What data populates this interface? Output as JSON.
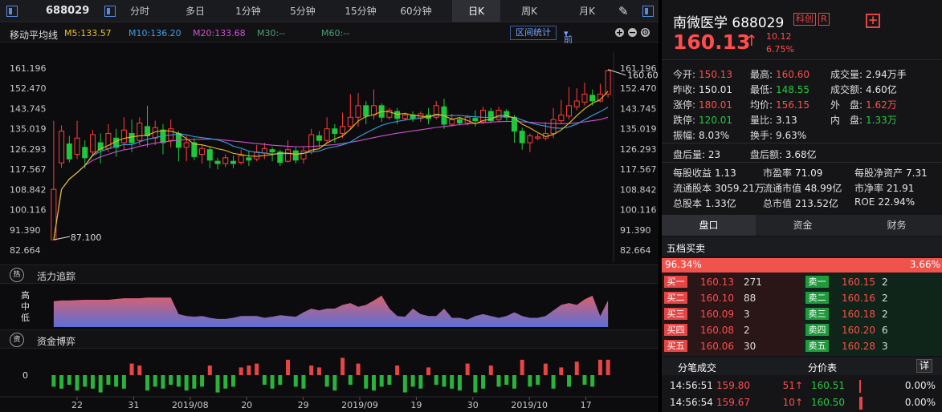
{
  "toolbar": {
    "code": "688029",
    "tabs": [
      "分时",
      "多日",
      "1分钟",
      "5分钟",
      "15分钟",
      "60分钟",
      "日K",
      "周K",
      "月K"
    ],
    "active_tab": "日K"
  },
  "ma_bar": {
    "title": "移动平均线",
    "ma5": "M5:133.57",
    "ma10": "M10:136.20",
    "ma20": "M20:133.68",
    "ma30": "M30:--",
    "ma60": "M60:--",
    "interval_btn": "区间统计",
    "adjust": "前复权",
    "colors": {
      "ma5": "#e8c020",
      "ma10": "#3aa0e6",
      "ma20": "#d050d0",
      "ma30": "#4aa070",
      "ma60": "#4aa070"
    }
  },
  "chart_data": {
    "type": "candlestick",
    "y_ticks": [
      "161.196",
      "152.470",
      "143.745",
      "135.019",
      "126.293",
      "117.567",
      "108.842",
      "100.116",
      "91.390",
      "82.664"
    ],
    "ylim": [
      82.664,
      161.196
    ],
    "x_ticks": [
      "22",
      "31",
      "2019/08",
      "20",
      "29",
      "2019/09",
      "19",
      "30",
      "2019/10",
      "17"
    ],
    "max_label": "160.600",
    "min_label": "87.100",
    "candles": [
      [
        87.1,
        108.9,
        87.1,
        138.5
      ],
      [
        120.3,
        134.0,
        118.2,
        136.5
      ],
      [
        128.5,
        122.0,
        120.5,
        132.0
      ],
      [
        124.0,
        131.0,
        122.0,
        138.5
      ],
      [
        127.0,
        122.5,
        118.0,
        130.0
      ],
      [
        125.0,
        132.5,
        124.0,
        134.5
      ],
      [
        129.0,
        126.0,
        120.0,
        133.0
      ],
      [
        126.5,
        133.0,
        125.0,
        137.0
      ],
      [
        131.0,
        127.0,
        123.0,
        135.0
      ],
      [
        129.0,
        134.5,
        126.0,
        140.0
      ],
      [
        133.0,
        129.0,
        125.0,
        139.0
      ],
      [
        130.0,
        137.5,
        128.0,
        140.0
      ],
      [
        136.0,
        132.0,
        127.0,
        145.0
      ],
      [
        131.0,
        135.5,
        128.0,
        138.5
      ],
      [
        134.5,
        129.0,
        124.0,
        137.0
      ],
      [
        130.0,
        135.0,
        127.0,
        139.0
      ],
      [
        133.0,
        127.0,
        121.0,
        134.0
      ],
      [
        127.0,
        129.0,
        121.0,
        132.0
      ],
      [
        129.0,
        123.0,
        121.5,
        131.0
      ],
      [
        124.0,
        126.5,
        120.0,
        128.0
      ],
      [
        126.0,
        121.5,
        118.0,
        127.5
      ],
      [
        121.0,
        120.0,
        117.5,
        122.5
      ],
      [
        120.0,
        122.5,
        118.5,
        124.0
      ],
      [
        121.0,
        120.0,
        118.0,
        123.5
      ],
      [
        120.5,
        123.5,
        119.5,
        126.0
      ],
      [
        122.5,
        121.5,
        119.0,
        125.5
      ],
      [
        122.0,
        125.0,
        121.0,
        128.0
      ],
      [
        124.5,
        126.5,
        122.0,
        129.0
      ],
      [
        126.0,
        125.0,
        121.0,
        127.0
      ],
      [
        125.0,
        120.5,
        119.0,
        126.0
      ],
      [
        121.0,
        126.0,
        120.5,
        130.0
      ],
      [
        125.5,
        121.5,
        120.0,
        127.0
      ],
      [
        122.0,
        125.5,
        120.0,
        127.5
      ],
      [
        125.0,
        132.5,
        124.0,
        135.0
      ],
      [
        132.0,
        130.0,
        127.0,
        134.0
      ],
      [
        130.0,
        135.0,
        129.0,
        140.0
      ],
      [
        135.0,
        133.0,
        129.0,
        137.0
      ],
      [
        133.0,
        136.0,
        131.0,
        142.0
      ],
      [
        136.0,
        140.0,
        135.0,
        150.0
      ],
      [
        140.0,
        145.0,
        136.0,
        150.5
      ],
      [
        145.0,
        140.5,
        137.0,
        147.0
      ],
      [
        141.0,
        145.0,
        139.0,
        152.0
      ],
      [
        145.0,
        140.0,
        138.0,
        146.0
      ],
      [
        140.0,
        143.0,
        139.0,
        144.0
      ],
      [
        142.5,
        139.5,
        137.0,
        144.0
      ],
      [
        139.5,
        141.0,
        138.5,
        142.0
      ],
      [
        141.0,
        139.5,
        138.0,
        142.5
      ],
      [
        139.5,
        141.5,
        138.0,
        142.5
      ],
      [
        141.0,
        139.5,
        137.0,
        144.0
      ],
      [
        140.0,
        145.0,
        139.0,
        147.0
      ],
      [
        144.5,
        137.0,
        135.0,
        148.0
      ],
      [
        137.0,
        139.0,
        136.0,
        141.5
      ],
      [
        139.0,
        137.5,
        136.5,
        140.0
      ],
      [
        137.5,
        140.0,
        136.5,
        141.0
      ],
      [
        139.5,
        138.5,
        136.0,
        143.0
      ],
      [
        138.0,
        143.0,
        137.0,
        144.5
      ],
      [
        142.5,
        138.5,
        137.5,
        144.0
      ],
      [
        139.0,
        143.0,
        138.0,
        144.5
      ],
      [
        142.5,
        140.0,
        138.5,
        143.5
      ],
      [
        140.0,
        134.0,
        129.0,
        141.0
      ],
      [
        134.0,
        129.0,
        126.0,
        135.5
      ],
      [
        129.0,
        132.0,
        125.0,
        133.0
      ],
      [
        131.0,
        131.5,
        130.0,
        133.0
      ],
      [
        131.0,
        133.0,
        130.0,
        138.0
      ],
      [
        133.0,
        139.0,
        131.0,
        144.0
      ],
      [
        138.5,
        141.0,
        137.0,
        147.5
      ],
      [
        140.5,
        145.0,
        139.0,
        153.0
      ],
      [
        144.5,
        147.0,
        143.0,
        152.5
      ],
      [
        146.5,
        150.0,
        145.0,
        155.0
      ],
      [
        149.5,
        147.0,
        145.0,
        152.0
      ],
      [
        147.0,
        150.0,
        146.5,
        154.5
      ],
      [
        150.0,
        160.13,
        148.55,
        160.6
      ]
    ],
    "ma5_values": [
      87.1,
      108.9,
      113.3,
      116.1,
      119.2,
      123.8,
      126.4,
      127.8,
      129.6,
      130.9,
      131.5,
      132.0,
      132.2,
      133.7,
      134.2,
      134.0,
      133.0,
      130.8,
      128.4,
      128.1,
      127.3,
      126.4,
      125.7,
      124.4,
      123.9,
      123.3,
      123.1,
      123.5,
      123.9,
      124.5,
      124.5,
      124.0,
      124.3,
      125.8,
      126.4,
      128.9,
      130.6,
      131.9,
      134.8,
      138.4,
      140.3,
      141.1,
      142.5,
      142.3,
      141.3,
      141.6,
      140.9,
      140.5,
      140.1,
      141.3,
      140.7,
      139.1,
      139.9,
      138.6,
      137.2,
      138.6,
      139.1,
      140.8,
      140.6,
      139.7,
      137.0,
      135.4,
      133.4,
      131.6,
      132.6,
      134.5,
      137.4,
      140.7,
      143.7,
      146.0,
      147.6,
      151.2
    ],
    "ma10_values": [
      87.1,
      108.9,
      113.3,
      116.1,
      119.2,
      123.4,
      125.3,
      126.4,
      127.4,
      128.2,
      128.2,
      129.4,
      130.5,
      131.2,
      132.0,
      132.3,
      132.8,
      132.4,
      131.6,
      131.2,
      130.8,
      130.2,
      129.2,
      127.5,
      126.6,
      125.4,
      124.8,
      124.6,
      124.1,
      124.2,
      124.3,
      124.2,
      124.5,
      125.0,
      125.4,
      126.6,
      127.3,
      128.1,
      129.3,
      131.4,
      133.2,
      134.9,
      136.5,
      137.5,
      138.2,
      138.8,
      139.2,
      139.7,
      140.1,
      140.9,
      140.7,
      140.7,
      140.8,
      140.4,
      140.2,
      140.0,
      139.9,
      140.1,
      140.2,
      139.9,
      138.8,
      137.6,
      136.8,
      136.2,
      135.4,
      135.2,
      135.8,
      137.1,
      138.9,
      140.8,
      142.4,
      144.3
    ],
    "ma20_values": [
      87.1,
      108.9,
      113.3,
      116.1,
      119.2,
      121.4,
      122.9,
      124.0,
      125.1,
      125.9,
      126.5,
      127.5,
      128.2,
      128.8,
      129.3,
      129.7,
      130.1,
      130.3,
      130.4,
      130.5,
      130.6,
      130.4,
      130.1,
      129.7,
      129.4,
      129.0,
      128.6,
      128.3,
      127.9,
      127.7,
      127.5,
      127.3,
      127.3,
      127.4,
      127.6,
      127.9,
      128.2,
      128.6,
      129.2,
      129.8,
      130.5,
      131.2,
      131.9,
      132.5,
      133.1,
      133.6,
      134.1,
      134.6,
      135.1,
      135.6,
      136.0,
      136.4,
      136.8,
      137.1,
      137.4,
      137.7,
      137.9,
      138.1,
      138.2,
      138.2,
      138.0,
      137.8,
      137.6,
      137.4,
      137.3,
      137.2,
      137.3,
      137.6,
      138.0,
      138.5,
      139.0,
      140.0
    ]
  },
  "section_activity": {
    "label": "活力追踪",
    "icon_char": "热",
    "y_labels": [
      "高",
      "中",
      "低"
    ],
    "values": [
      0.7,
      0.72,
      0.72,
      0.73,
      0.74,
      0.74,
      0.74,
      0.74,
      0.76,
      0.78,
      0.78,
      0.78,
      0.8,
      0.8,
      0.8,
      0.8,
      0.35,
      0.3,
      0.28,
      0.3,
      0.25,
      0.22,
      0.22,
      0.25,
      0.3,
      0.3,
      0.3,
      0.25,
      0.28,
      0.32,
      0.3,
      0.28,
      0.4,
      0.5,
      0.45,
      0.5,
      0.5,
      0.6,
      0.65,
      0.55,
      0.6,
      0.72,
      0.85,
      0.5,
      0.3,
      0.28,
      0.5,
      0.35,
      0.3,
      0.3,
      0.5,
      0.25,
      0.25,
      0.2,
      0.3,
      0.35,
      0.3,
      0.25,
      0.3,
      0.4,
      0.3,
      0.25,
      0.25,
      0.3,
      0.45,
      0.6,
      0.65,
      0.6,
      0.75,
      0.85,
      0.3,
      0.72
    ]
  },
  "section_fund": {
    "label": "资金博弈",
    "icon_char": "资",
    "zero_label": "0",
    "values": [
      -0.6,
      -0.7,
      -0.5,
      -0.8,
      -0.6,
      -0.7,
      -0.9,
      -0.5,
      -0.6,
      -0.7,
      0.6,
      0.5,
      -0.8,
      -0.6,
      -0.7,
      -0.5,
      -0.6,
      -0.8,
      -0.7,
      -0.6,
      0.5,
      -0.9,
      -0.7,
      -0.6,
      0.4,
      0.5,
      0.6,
      -0.5,
      -0.7,
      -0.5,
      0.8,
      -0.6,
      -0.7,
      0.5,
      0.4,
      -0.6,
      -0.8,
      0.9,
      -0.5,
      0.6,
      -0.7,
      -0.8,
      -0.6,
      -0.5,
      0.5,
      -0.9,
      -0.6,
      -0.7,
      0.4,
      -0.5,
      -0.6,
      -0.7,
      -0.8,
      0.6,
      -0.9,
      -0.7,
      0.5,
      -0.6,
      -0.5,
      -0.7,
      0.8,
      -0.6,
      -0.5,
      0.6,
      -0.7,
      0.4,
      -0.6,
      0.7,
      -0.5,
      -0.6,
      0.8,
      0.8
    ]
  },
  "quote": {
    "name": "南微医学",
    "code": "688029",
    "board_tag": "科创",
    "r_tag": "R",
    "plus": "+",
    "price": "160.13",
    "arrow": "↑",
    "change": "10.12",
    "change_pct": "6.75%",
    "stats": [
      {
        "label": "今开:",
        "value": "150.13",
        "cls": "red"
      },
      {
        "label": "最高:",
        "value": "160.60",
        "cls": "red"
      },
      {
        "label": "成交量:",
        "value": "2.94万手",
        "cls": "white"
      },
      {
        "label": "昨收:",
        "value": "150.01",
        "cls": "white"
      },
      {
        "label": "最低:",
        "value": "148.55",
        "cls": "green"
      },
      {
        "label": "成交额:",
        "value": "4.60亿",
        "cls": "white"
      },
      {
        "label": "涨停:",
        "value": "180.01",
        "cls": "red"
      },
      {
        "label": "均价:",
        "value": "156.15",
        "cls": "red"
      },
      {
        "label": "外　盘:",
        "value": "1.62万",
        "cls": "red"
      },
      {
        "label": "跌停:",
        "value": "120.01",
        "cls": "green"
      },
      {
        "label": "量比:",
        "value": "3.13",
        "cls": "white"
      },
      {
        "label": "内　盘:",
        "value": "1.33万",
        "cls": "green"
      },
      {
        "label": "振幅:",
        "value": "8.03%",
        "cls": "white"
      },
      {
        "label": "换手:",
        "value": "9.63%",
        "cls": "white"
      }
    ],
    "after_vol_label": "盘后量:",
    "after_vol": "23",
    "after_amt_label": "盘后额:",
    "after_amt": "3.68亿",
    "fundamentals": [
      {
        "label": "每股收益",
        "value": "1.13"
      },
      {
        "label": "市盈率",
        "value": "71.09"
      },
      {
        "label": "每股净资产",
        "value": "7.31"
      },
      {
        "label": "流通股本",
        "value": "3059.21万"
      },
      {
        "label": "流通市值",
        "value": "48.99亿"
      },
      {
        "label": "市净率",
        "value": "21.91"
      },
      {
        "label": "总股本",
        "value": "1.33亿"
      },
      {
        "label": "总市值",
        "value": "213.52亿"
      },
      {
        "label": "ROE",
        "value": "22.94%"
      }
    ]
  },
  "right_tabs": [
    "盘口",
    "资金",
    "财务"
  ],
  "orderbook": {
    "title": "五档买卖",
    "bid_ratio": "96.34%",
    "ask_ratio": "3.66%",
    "buy": [
      {
        "tag": "买一",
        "price": "160.13",
        "vol": "271"
      },
      {
        "tag": "买二",
        "price": "160.10",
        "vol": "88"
      },
      {
        "tag": "买三",
        "price": "160.09",
        "vol": "3"
      },
      {
        "tag": "买四",
        "price": "160.08",
        "vol": "2"
      },
      {
        "tag": "买五",
        "price": "160.06",
        "vol": "30"
      }
    ],
    "sell": [
      {
        "tag": "卖一",
        "price": "160.15",
        "vol": "2"
      },
      {
        "tag": "卖二",
        "price": "160.16",
        "vol": "2"
      },
      {
        "tag": "卖三",
        "price": "160.18",
        "vol": "2"
      },
      {
        "tag": "卖四",
        "price": "160.20",
        "vol": "6"
      },
      {
        "tag": "卖五",
        "price": "160.28",
        "vol": "3"
      }
    ]
  },
  "trades": {
    "tab1": "分笔成交",
    "tab2": "分价表",
    "detail": "详",
    "rows": [
      {
        "time": "14:56:51",
        "price": "159.80",
        "vol": "51↑",
        "pp": "160.51",
        "pct": "0.00%",
        "bar": 0.3
      },
      {
        "time": "14:56:54",
        "price": "159.67",
        "vol": "10↑",
        "pp": "160.50",
        "pct": "0.00%",
        "bar": 0.5
      }
    ]
  }
}
